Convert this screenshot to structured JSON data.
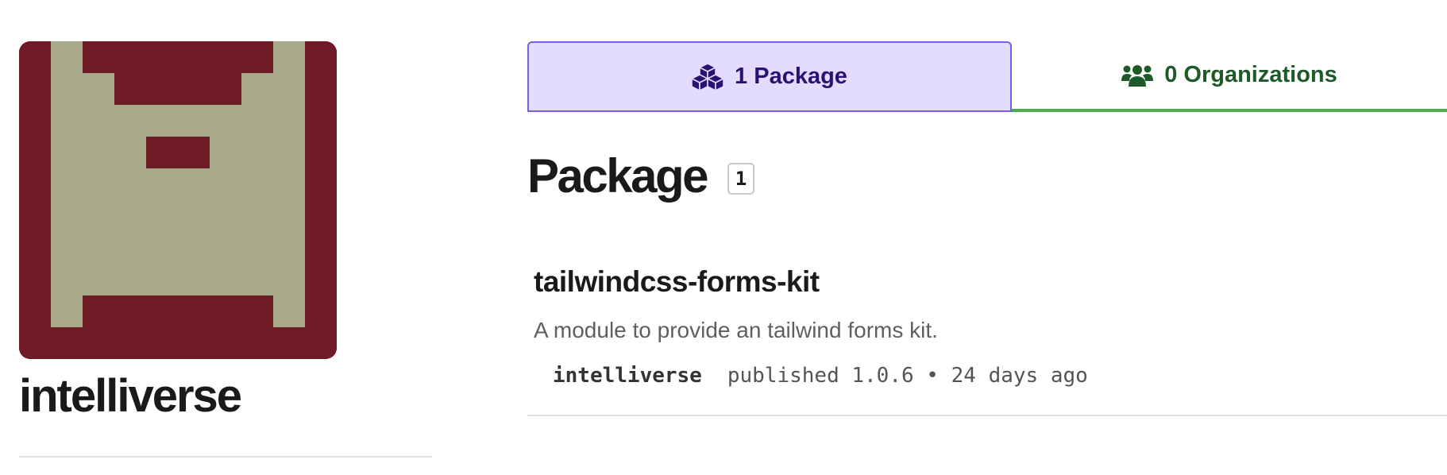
{
  "profile": {
    "username": "intelliverse",
    "avatar_colors": {
      "background": "#701c27",
      "foreground": "#a9aa8a"
    }
  },
  "tabs": [
    {
      "label": "1 Package",
      "icon": "cubes-icon",
      "active": true,
      "color": "#2a1275",
      "background": "#e3dcff",
      "border": "#7b5be6"
    },
    {
      "label": "0 Organizations",
      "icon": "users-icon",
      "active": false,
      "color": "#1e5a28",
      "underline": "#4caf50"
    }
  ],
  "section": {
    "title": "Package",
    "count": "1"
  },
  "packages": [
    {
      "name": "tailwindcss-forms-kit",
      "description": "A module to provide an tailwind forms kit.",
      "publisher": "intelliverse",
      "published_text": "published 1.0.6 • 24 days ago"
    }
  ]
}
